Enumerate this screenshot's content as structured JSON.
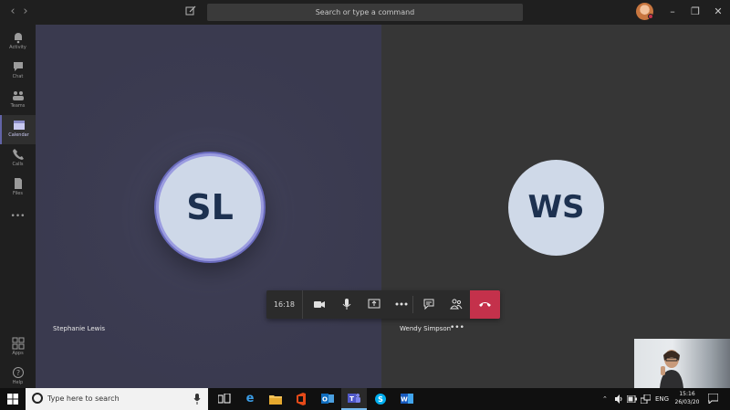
{
  "titlebar": {
    "search_placeholder": "Search or type a command",
    "back_icon": "chevron-left-icon",
    "forward_icon": "chevron-right-icon",
    "compose_icon": "compose-icon",
    "status_color": "#c4314b",
    "minimize": "–",
    "maximize": "❐",
    "close": "✕"
  },
  "rail": {
    "items": [
      {
        "label": "Activity",
        "icon": "bell-icon"
      },
      {
        "label": "Chat",
        "icon": "chat-icon"
      },
      {
        "label": "Teams",
        "icon": "teams-icon"
      },
      {
        "label": "Calendar",
        "icon": "calendar-icon",
        "active": true
      },
      {
        "label": "Calls",
        "icon": "phone-icon"
      },
      {
        "label": "Files",
        "icon": "files-icon"
      },
      {
        "label": "•••",
        "icon": "more-icon"
      }
    ],
    "bottom": [
      {
        "label": "Apps",
        "icon": "apps-icon"
      },
      {
        "label": "Help",
        "icon": "help-icon"
      }
    ]
  },
  "call": {
    "participants": [
      {
        "initials": "SL",
        "name": "Stephanie Lewis"
      },
      {
        "initials": "WS",
        "name": "Wendy Simpson"
      }
    ],
    "more_options": "•••",
    "timer": "16:18",
    "accent": "#6264a7",
    "hangup_color": "#c4314b"
  },
  "taskbar": {
    "search_placeholder": "Type here to search",
    "apps": [
      "task-view-icon",
      "edge-icon",
      "file-explorer-icon",
      "office-icon",
      "outlook-icon",
      "teams-icon",
      "skype-icon",
      "word-icon"
    ],
    "language": "ENG",
    "time": "15:16",
    "date": "26/03/20"
  }
}
